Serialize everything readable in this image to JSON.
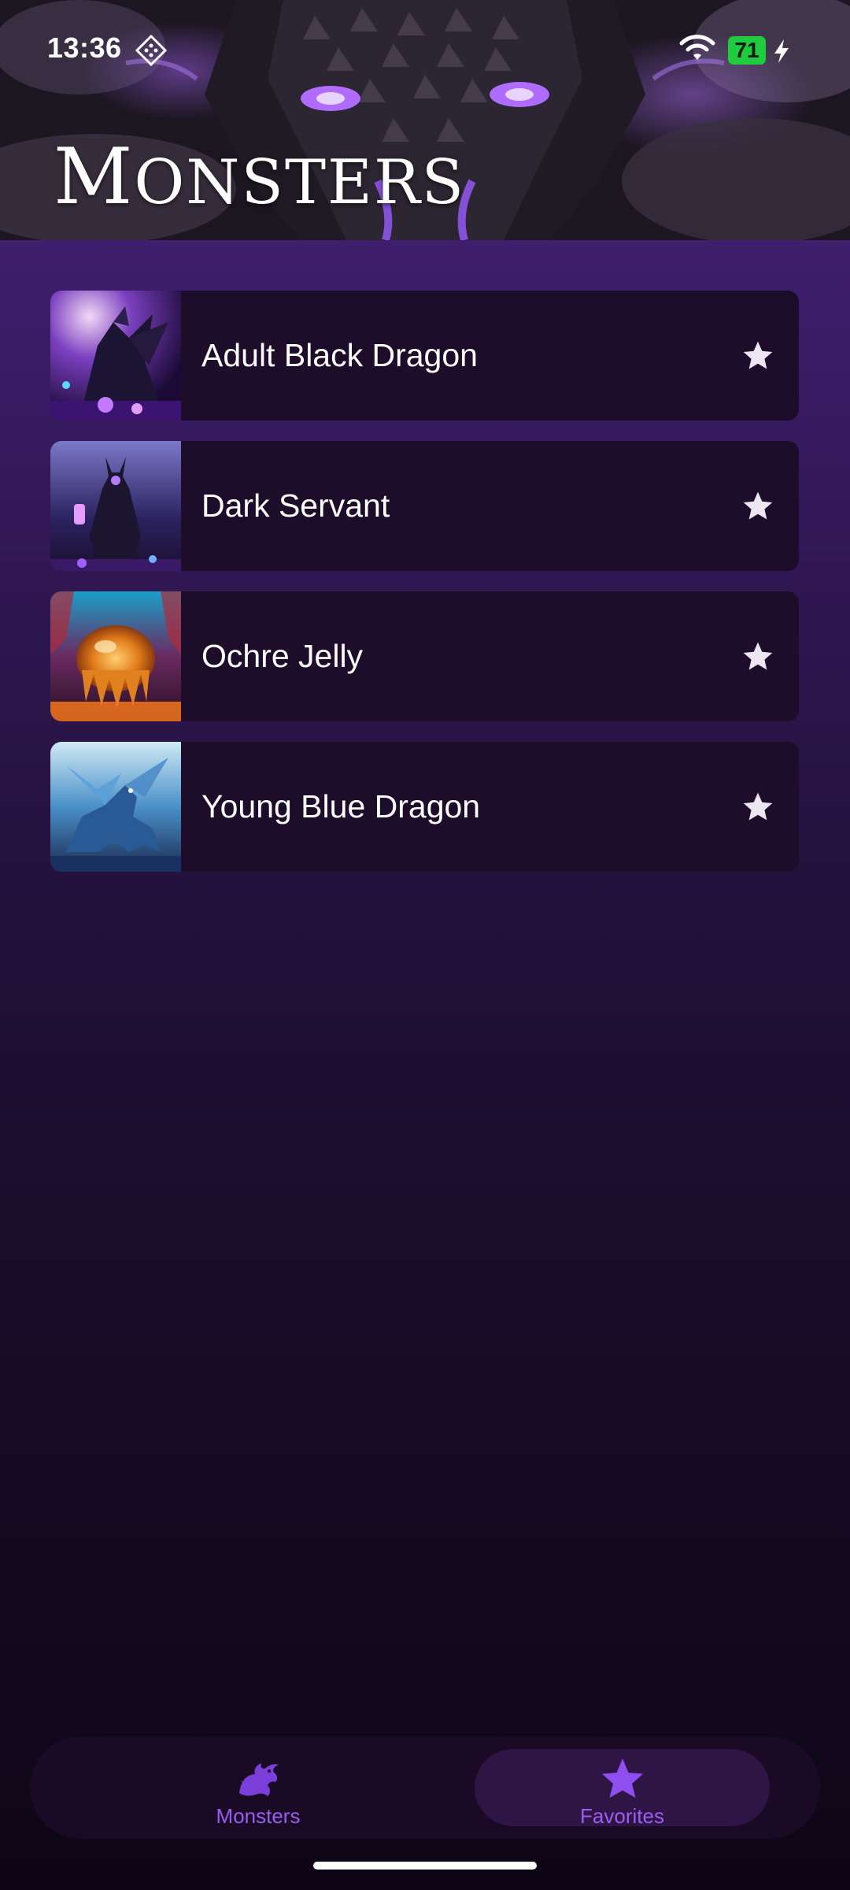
{
  "status_bar": {
    "time": "13:36",
    "battery": "71"
  },
  "header": {
    "title_first": "M",
    "title_rest": "ONSTERS"
  },
  "monsters": [
    {
      "name": "Adult Black Dragon",
      "icon": "star-icon"
    },
    {
      "name": "Dark Servant",
      "icon": "star-icon"
    },
    {
      "name": "Ochre Jelly",
      "icon": "star-icon"
    },
    {
      "name": "Young Blue Dragon",
      "icon": "star-icon"
    }
  ],
  "nav": {
    "items": [
      {
        "label": "Monsters",
        "icon": "dragon-icon",
        "active": false
      },
      {
        "label": "Favorites",
        "icon": "star-icon",
        "active": true
      }
    ]
  },
  "colors": {
    "accent": "#9b5cf0",
    "card_bg": "#1e0c2b",
    "nav_bg": "#1a0a26",
    "battery": "#1fcb3f"
  }
}
